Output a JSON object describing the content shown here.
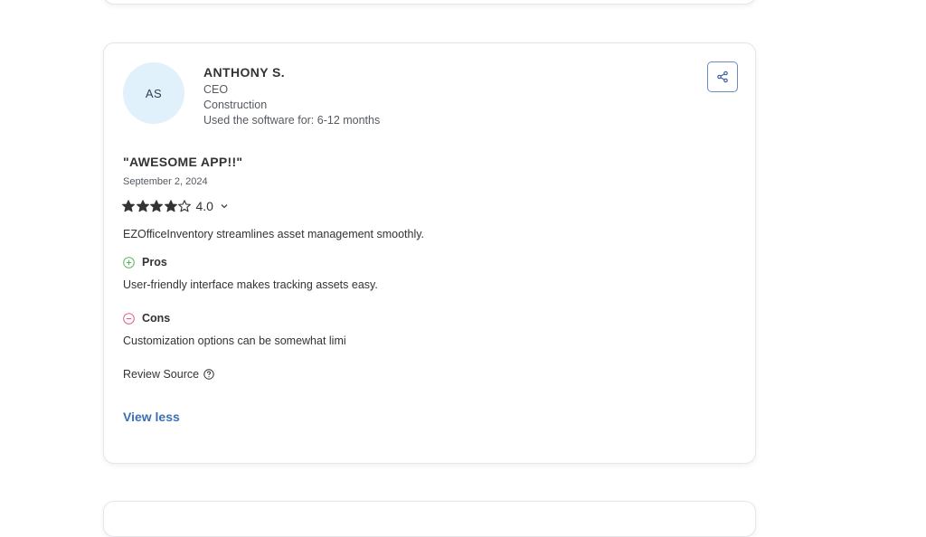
{
  "review": {
    "avatar_initials": "AS",
    "reviewer_name": "ANTHONY S.",
    "reviewer_role": "CEO",
    "reviewer_industry": "Construction",
    "usage_duration": "Used the software for: 6-12 months",
    "title": "\"AWESOME APP!!\"",
    "date": "September 2, 2024",
    "rating_value": "4.0",
    "rating_stars": 4,
    "rating_max": 5,
    "body": "EZOfficeInventory streamlines asset management smoothly.",
    "pros_label": "Pros",
    "pros_text": "User-friendly interface makes tracking assets easy.",
    "cons_label": "Cons",
    "cons_text": "Customization options can be somewhat limi",
    "source_label": "Review Source",
    "view_less_label": "View less"
  },
  "icons": {
    "share": "share-icon",
    "star": "star-icon",
    "chevron": "chevron-down-icon",
    "pros": "plus-circle-icon",
    "cons": "minus-circle-icon",
    "help": "question-circle-icon"
  },
  "colors": {
    "link": "#3b6fb6",
    "pros": "#5cb85c",
    "cons": "#e0607e",
    "avatar_bg": "#e1f1fb",
    "share_border": "#6a8cbf"
  }
}
